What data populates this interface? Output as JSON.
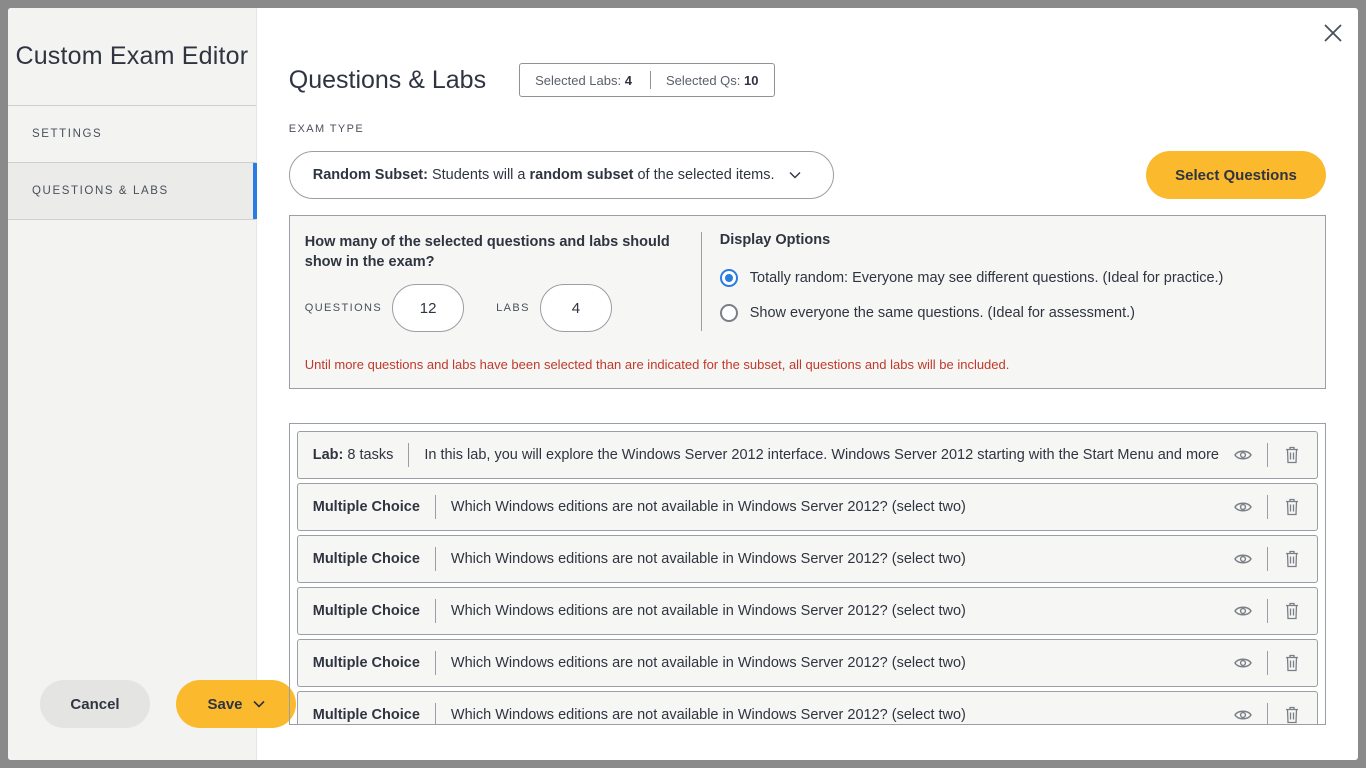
{
  "sidebar": {
    "title": "Custom Exam Editor",
    "items": [
      {
        "label": "SETTINGS"
      },
      {
        "label": "QUESTIONS & LABS"
      }
    ],
    "cancel_label": "Cancel",
    "save_label": "Save"
  },
  "header": {
    "title": "Questions & Labs",
    "selected_labs_label": "Selected Labs:",
    "selected_labs_count": "4",
    "selected_qs_label": "Selected Qs:",
    "selected_qs_count": "10"
  },
  "exam_type": {
    "label": "EXAM TYPE",
    "selected_strong": "Random Subset:",
    "selected_text_1": " Students will a ",
    "selected_emph": "random subset",
    "selected_text_2": " of the selected items."
  },
  "select_questions_label": "Select Questions",
  "subset": {
    "question": "How many of the selected questions and labs should show in the exam?",
    "questions_label": "QUESTIONS",
    "questions_value": "12",
    "labs_label": "LABS",
    "labs_value": "4",
    "display_title": "Display Options",
    "option_1": "Totally random: Everyone may see different questions. (Ideal for practice.)",
    "option_2": "Show everyone the same questions. (Ideal for assessment.)",
    "warning": "Until more questions and labs have been selected than are indicated for the subset, all questions and labs will be included."
  },
  "items": [
    {
      "type": "Lab:",
      "type_extra": " 8 tasks",
      "text": "In this lab, you will explore the Windows Server 2012 interface. Windows Server 2012 starting with the Start Menu and more"
    },
    {
      "type": "Multiple Choice",
      "type_extra": "",
      "text": "Which Windows editions are not available in Windows Server 2012? (select two)"
    },
    {
      "type": "Multiple Choice",
      "type_extra": "",
      "text": "Which Windows editions are not available in Windows Server 2012? (select two)"
    },
    {
      "type": "Multiple Choice",
      "type_extra": "",
      "text": "Which Windows editions are not available in Windows Server 2012? (select two)"
    },
    {
      "type": "Multiple Choice",
      "type_extra": "",
      "text": "Which Windows editions are not available in Windows Server 2012? (select two)"
    },
    {
      "type": "Multiple Choice",
      "type_extra": "",
      "text": "Which Windows editions are not available in Windows Server 2012? (select two)"
    }
  ],
  "colors": {
    "accent": "#fbb92d",
    "active_indicator": "#2a7be4",
    "warning": "#c0392b"
  }
}
